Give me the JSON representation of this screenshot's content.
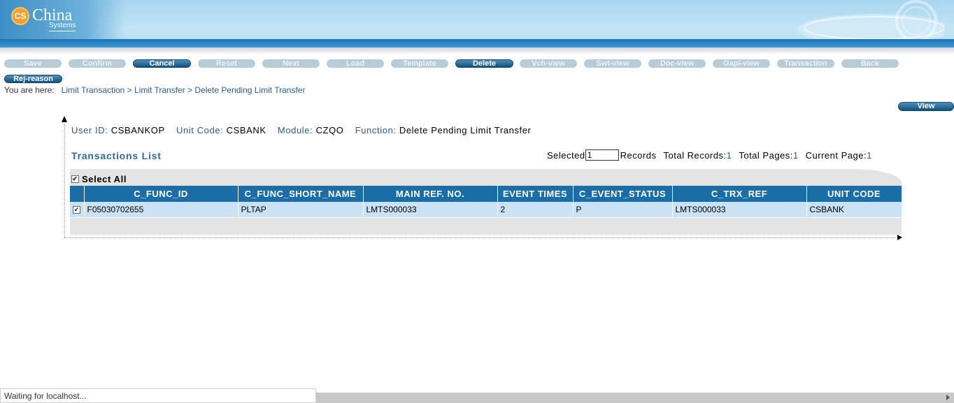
{
  "header": {
    "logo_mark": "CS",
    "logo_title": "China",
    "logo_sub": "Systems"
  },
  "toolbar": {
    "buttons": [
      {
        "label": "Save",
        "enabled": false
      },
      {
        "label": "Confirm",
        "enabled": false
      },
      {
        "label": "Cancel",
        "enabled": true
      },
      {
        "label": "Reset",
        "enabled": false
      },
      {
        "label": "Next",
        "enabled": false
      },
      {
        "label": "Load",
        "enabled": false
      },
      {
        "label": "Template",
        "enabled": false
      },
      {
        "label": "Delete",
        "enabled": true
      },
      {
        "label": "Vch-view",
        "enabled": false
      },
      {
        "label": "Swt-view",
        "enabled": false
      },
      {
        "label": "Doc-view",
        "enabled": false
      },
      {
        "label": "Gapi-view",
        "enabled": false
      },
      {
        "label": "Transaction",
        "enabled": false
      },
      {
        "label": "Back",
        "enabled": false
      },
      {
        "label": "Rej-reason",
        "enabled": true
      }
    ],
    "view_label": "View"
  },
  "breadcrumb": {
    "prefix": "You are here:",
    "path": "Limit Transaction > Limit Transfer > Delete Pending Limit Transfer"
  },
  "info": {
    "user_id_label": "User ID:",
    "user_id": "CSBANKOP",
    "unit_code_label": "Unit Code:",
    "unit_code": "CSBANK",
    "module_label": "Module:",
    "module": "CZQO",
    "function_label": "Function:",
    "function": "Delete Pending Limit Transfer"
  },
  "list": {
    "title": "Transactions List",
    "selected_label": "Selected",
    "selected_value": "1",
    "records_label": "Records",
    "total_records_label": "Total Records:",
    "total_records": "1",
    "total_pages_label": "Total Pages:",
    "total_pages": "1",
    "current_page_label": "Current Page:",
    "current_page": "1",
    "select_all_label": "Select All",
    "select_all_checked": true,
    "columns": [
      "C_FUNC_ID",
      "C_FUNC_SHORT_NAME",
      "MAIN REF. NO.",
      "EVENT TIMES",
      "C_EVENT_STATUS",
      "C_TRX_REF",
      "UNIT CODE"
    ],
    "rows": [
      {
        "checked": true,
        "cells": [
          "F05030702655",
          "PLTAP",
          "LMTS000033",
          "2",
          "P",
          "LMTS000033",
          "CSBANK"
        ]
      }
    ]
  },
  "status": {
    "text": "Waiting for localhost..."
  },
  "colors": {
    "header_blue": "#1a6da6",
    "row_blue": "#c9e2f5",
    "label_blue": "#2e5c86"
  }
}
